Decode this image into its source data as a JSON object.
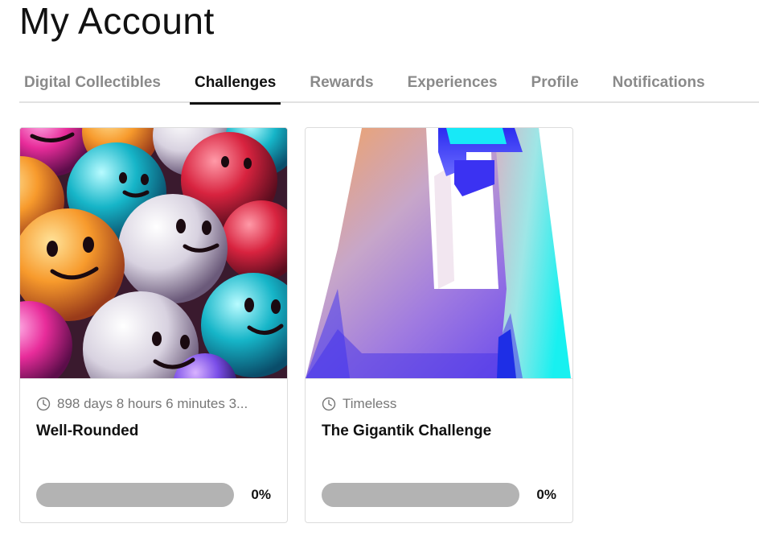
{
  "page": {
    "title": "My Account"
  },
  "tabs": [
    {
      "label": "Digital Collectibles",
      "active": false
    },
    {
      "label": "Challenges",
      "active": true
    },
    {
      "label": "Rewards",
      "active": false
    },
    {
      "label": "Experiences",
      "active": false
    },
    {
      "label": "Profile",
      "active": false
    },
    {
      "label": "Notifications",
      "active": false
    }
  ],
  "challenges": [
    {
      "image": "smiley-balls-image",
      "time_icon": "clock-icon",
      "time_text": "898 days 8 hours 6 minutes 3...",
      "title": "Well-Rounded",
      "progress": 0,
      "progress_label": "0%"
    },
    {
      "image": "gigantik-logo-image",
      "time_icon": "clock-icon",
      "time_text": "Timeless",
      "title": "The Gigantik Challenge",
      "progress": 0,
      "progress_label": "0%"
    }
  ],
  "colors": {
    "progress_track": "#b3b3b3",
    "active_tab": "#111111",
    "inactive_tab": "#8a8a8a"
  }
}
